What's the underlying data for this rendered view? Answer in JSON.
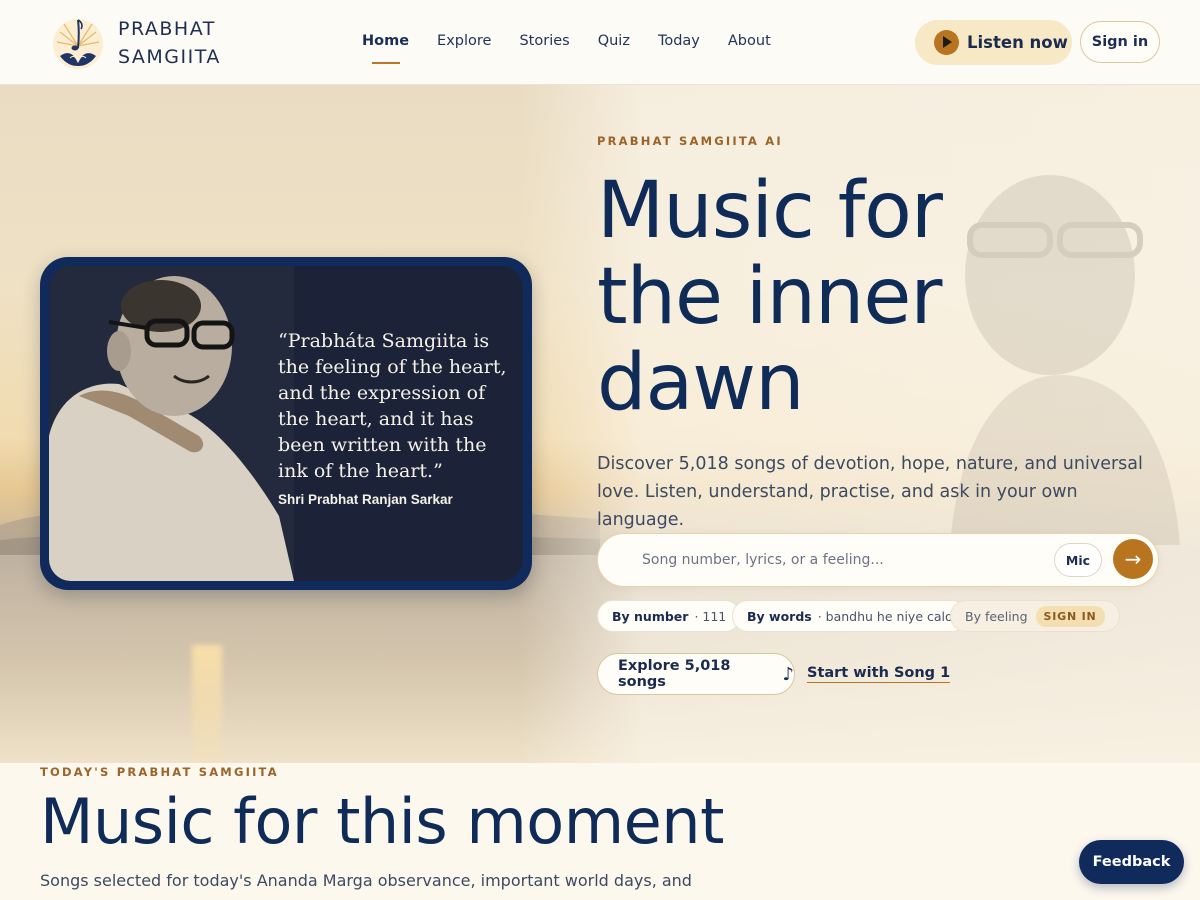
{
  "header": {
    "brand_line1": "PRABHAT",
    "brand_line2": "SAMGIITA",
    "nav": [
      {
        "label": "Home",
        "active": true
      },
      {
        "label": "Explore"
      },
      {
        "label": "Stories"
      },
      {
        "label": "Quiz"
      },
      {
        "label": "Today"
      },
      {
        "label": "About"
      }
    ],
    "listen_label": "Listen now",
    "signin_label": "Sign in"
  },
  "hero": {
    "eyebrow": "PRABHAT SAMGIITA AI",
    "headline": "Music for the inner dawn",
    "subtext": "Discover 5,018 songs of devotion, hope, nature, and universal love. Listen, understand, practise, and ask in your own language.",
    "quote": "“Prabháta Samgiita is the feeling of the heart, and the expression of the heart, and it has been written with the ink of the heart.”",
    "quote_author": "Shri Prabhat Ranjan Sarkar",
    "search": {
      "placeholder": "Song number, lyrics, or a feeling...",
      "mic_label": "Mic",
      "go_icon": "arrow-right-icon"
    },
    "chips": [
      {
        "label": "By number",
        "example": "· 111"
      },
      {
        "label": "By words",
        "example": "· bandhu he niye calo"
      },
      {
        "label": "By feeling",
        "badge": "SIGN IN"
      }
    ],
    "explore_label": "Explore 5,018 songs",
    "explore_icon": "♪",
    "start_label": "Start with Song 1"
  },
  "today": {
    "eyebrow": "TODAY'S PRABHAT SAMGIITA",
    "title": "Music for this moment",
    "subtext": "Songs selected for today's Ananda Marga observance, important world days, and"
  },
  "feedback_label": "Feedback",
  "colors": {
    "navy": "#0f2b58",
    "accent": "#b8741f",
    "cream": "#fdf8ee"
  }
}
